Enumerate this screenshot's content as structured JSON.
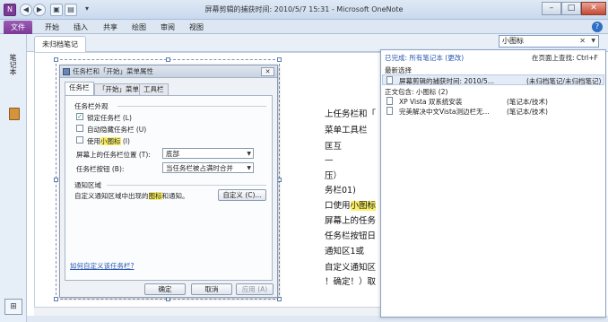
{
  "window": {
    "title": "屏幕剪辑的捕获时间: 2010/5/7 15:31 - Microsoft OneNote",
    "minimize_label": "–",
    "maximize_label": "□",
    "close_label": "✕"
  },
  "quick_access": {
    "back_label": "◀",
    "forward_label": "▶",
    "dock_label": "▣",
    "view_label": "▤",
    "more_label": "▾"
  },
  "ribbon": {
    "file_tab": "文件",
    "tabs": [
      "开始",
      "插入",
      "共享",
      "绘图",
      "审阅",
      "视图"
    ],
    "help_label": "?"
  },
  "nav": {
    "label": "笔记本",
    "bottom_label": "⊞"
  },
  "section": {
    "tab_label": "未归档笔记"
  },
  "search": {
    "value": "小图标",
    "clear_label": "✕",
    "dropdown_label": "▼"
  },
  "results": {
    "done_prefix": "已完成:",
    "scope_link": "所有笔记本 (更改)",
    "find_on_page": "在页面上查找: Ctrl+F",
    "recent_header": "最新选择",
    "recent_item_title": "屏幕剪辑的捕获时间: 2010/5...",
    "recent_item_location": "(未归档笔记/未归档笔记)",
    "body_header": "正文包含: 小图标 (2)",
    "items": [
      {
        "title": "XP Vista 双系统安装",
        "location": "(笔记本/技术)"
      },
      {
        "title": "完美解决中文Vista测边栏无...",
        "location": "(笔记本/技术)"
      }
    ]
  },
  "note_lines": [
    {
      "pre": "上任务栏和「",
      "hl": "",
      "post": ""
    },
    {
      "pre": "菜单工具栏",
      "hl": "",
      "post": ""
    },
    {
      "pre": "匡互",
      "hl": "",
      "post": ""
    },
    {
      "pre": "—",
      "hl": "",
      "post": ""
    },
    {
      "pre": "压）",
      "hl": "",
      "post": ""
    },
    {
      "pre": "务栏01)",
      "hl": "",
      "post": ""
    },
    {
      "pre": "口使用",
      "hl": "小图标",
      "post": ""
    },
    {
      "pre": "屏幕上的任务",
      "hl": "",
      "post": ""
    },
    {
      "pre": "任务栏按钮日",
      "hl": "",
      "post": ""
    },
    {
      "pre": "通知区1或",
      "hl": "",
      "post": ""
    },
    {
      "pre": "自定义通知区",
      "hl": "",
      "post": ""
    },
    {
      "pre": "！确定！）取",
      "hl": "",
      "post": ""
    }
  ],
  "dialog": {
    "title": "任务栏和「开始」菜单属性",
    "close_label": "✕",
    "tabs": [
      "任务栏",
      "「开始」菜单",
      "工具栏"
    ],
    "appearance_group": "任务栏外观",
    "checkboxes": [
      {
        "label": "锁定任务栏 (L)",
        "checked": true
      },
      {
        "label": "自动隐藏任务栏 (U)",
        "checked": false
      },
      {
        "label_pre": "使用",
        "label_hl": "小图标",
        "label_post": " (I)",
        "checked": false
      }
    ],
    "position_label": "屏幕上的任务栏位置 (T):",
    "position_value": "底部",
    "buttons_label": "任务栏按钮 (B):",
    "buttons_value": "当任务栏被占满时合并",
    "notify_group": "通知区域",
    "notify_text_pre": "自定义通知区域中出现的",
    "notify_text_hl": "图标",
    "notify_text_post": "和通知。",
    "customize_button": "自定义 (C)...",
    "help_link": "如何自定义该任务栏?",
    "ok_button": "确定",
    "cancel_button": "取消",
    "apply_button": "应用 (A)"
  },
  "colors": {
    "accent": "#7a3a96",
    "highlight": "#fbf06a",
    "link": "#2757b0"
  }
}
